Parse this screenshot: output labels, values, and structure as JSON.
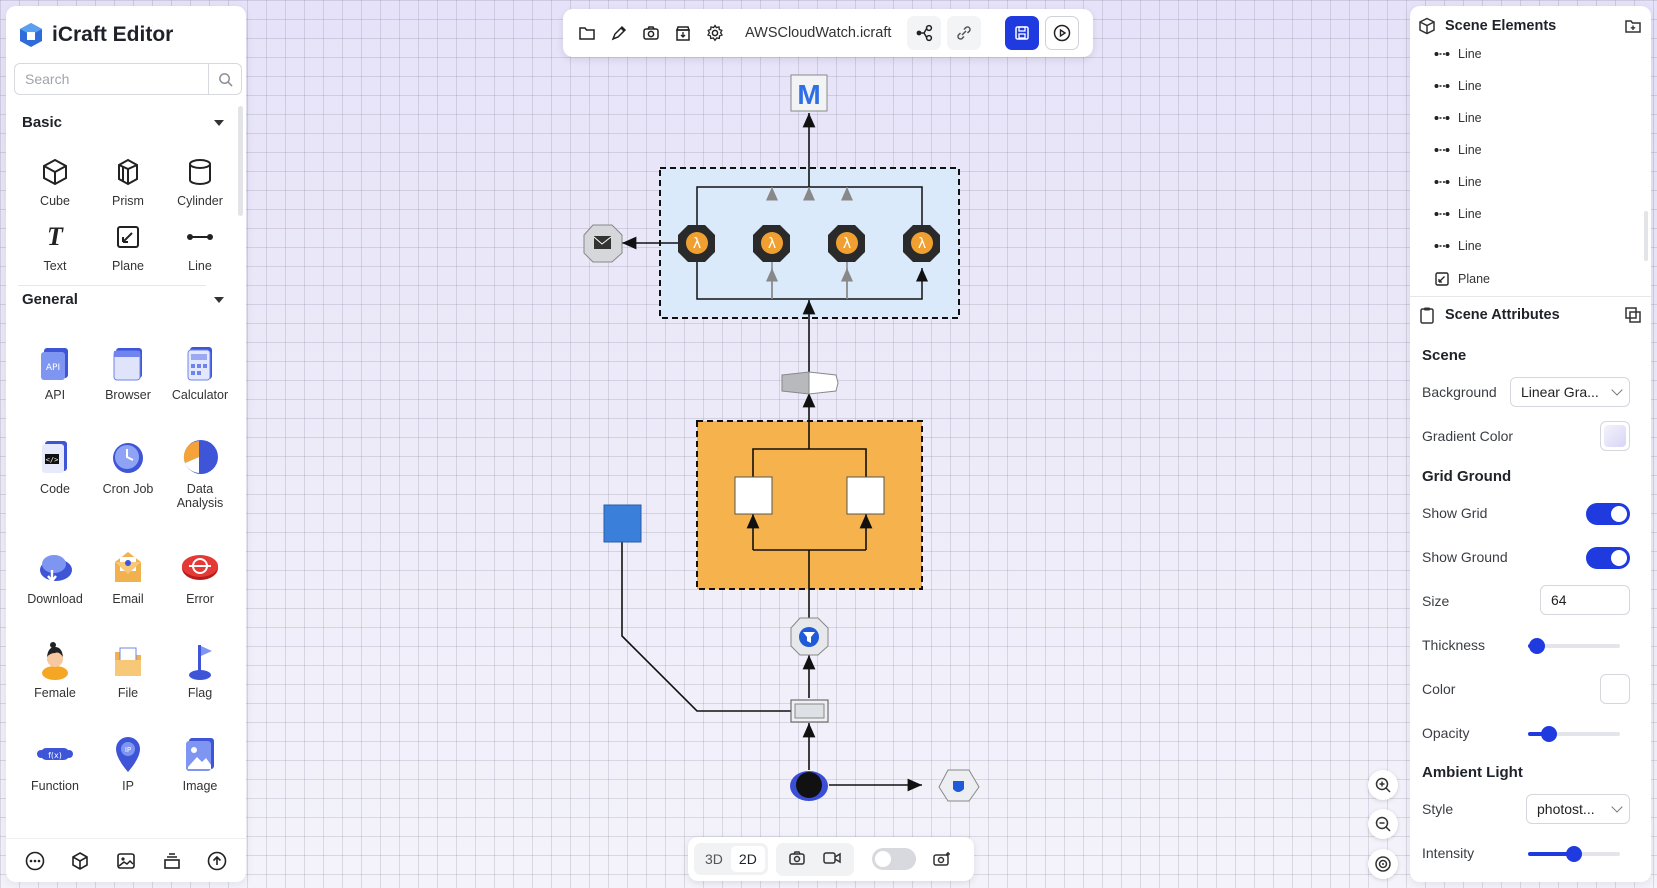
{
  "app": {
    "title": "iCraft Editor"
  },
  "search": {
    "placeholder": "Search"
  },
  "left_panel": {
    "sections": [
      {
        "title": "Basic",
        "items": [
          "Cube",
          "Prism",
          "Cylinder",
          "Text",
          "Plane",
          "Line"
        ]
      },
      {
        "title": "General",
        "items": [
          "API",
          "Browser",
          "Calculator",
          "Code",
          "Cron Job",
          "Data Analysis",
          "Download",
          "Email",
          "Error",
          "Female",
          "File",
          "Flag",
          "Function",
          "IP",
          "Image"
        ]
      }
    ],
    "bottom_icons": [
      "more-icon",
      "3d-model-icon",
      "image-icon",
      "layers-icon",
      "upload-icon"
    ]
  },
  "toolbar": {
    "filename": "AWSCloudWatch.icraft",
    "icons": [
      "folder-icon",
      "brush-icon",
      "camera-icon",
      "archive-icon",
      "gear-icon",
      "connect-icon",
      "link-icon",
      "save-icon",
      "play-icon"
    ]
  },
  "bottom_toolbar": {
    "mode_3d": "3D",
    "mode_2d": "2D",
    "active_mode": "2D",
    "toggle_on": false
  },
  "scene_elements": {
    "title": "Scene Elements",
    "items": [
      "Line",
      "Line",
      "Line",
      "Line",
      "Line",
      "Line",
      "Line",
      "Plane"
    ]
  },
  "scene_attributes": {
    "title": "Scene Attributes",
    "scene_title": "Scene",
    "background_label": "Background",
    "background_value": "Linear Gra...",
    "gradient_color_label": "Gradient Color",
    "gradient_color": "#e4e2f8",
    "grid_title": "Grid Ground",
    "show_grid_label": "Show Grid",
    "show_grid": true,
    "show_ground_label": "Show Ground",
    "show_ground": true,
    "size_label": "Size",
    "size_value": "64",
    "thickness_label": "Thickness",
    "thickness": 0.1,
    "color_label": "Color",
    "color": "#ffffff",
    "opacity_label": "Opacity",
    "opacity": 0.23,
    "ambient_title": "Ambient Light",
    "style_label": "Style",
    "style_value": "photost...",
    "intensity_label": "Intensity",
    "intensity": 0.5
  },
  "colors": {
    "accent": "#1f3bdf",
    "lambda": "#f0a030",
    "group_fill": "#f6b24c",
    "group_blue": "#dbeafb"
  }
}
